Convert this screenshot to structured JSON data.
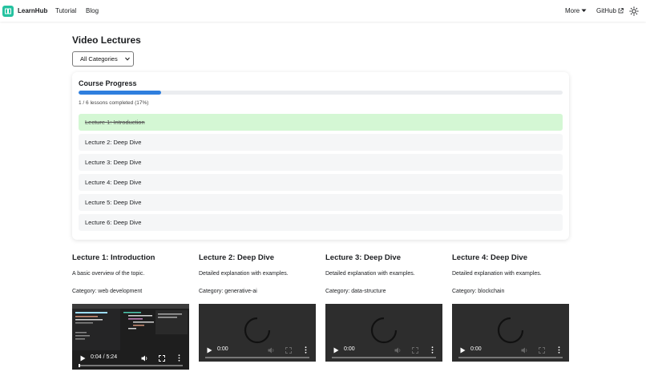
{
  "navbar": {
    "brand": "LearnHub",
    "links": [
      "Tutorial",
      "Blog"
    ],
    "more": "More",
    "github": "GitHub"
  },
  "page": {
    "title": "Video Lectures",
    "category_select": "All Categories"
  },
  "progress": {
    "title": "Course Progress",
    "fraction": 0.17,
    "text": "1 / 6 lessons completed (17%)",
    "lessons": [
      {
        "label": "Lecture 1: Introduction",
        "done": true
      },
      {
        "label": "Lecture 2: Deep Dive",
        "done": false
      },
      {
        "label": "Lecture 3: Deep Dive",
        "done": false
      },
      {
        "label": "Lecture 4: Deep Dive",
        "done": false
      },
      {
        "label": "Lecture 5: Deep Dive",
        "done": false
      },
      {
        "label": "Lecture 6: Deep Dive",
        "done": false
      }
    ]
  },
  "lectures": [
    {
      "title": "Lecture 1: Introduction",
      "desc": "A basic overview of the topic.",
      "category": "Category: web development",
      "time": "0:04 / 5:24",
      "played": 0.012
    },
    {
      "title": "Lecture 2: Deep Dive",
      "desc": "Detailed explanation with examples.",
      "category": "Category: generative-ai",
      "time": "0:00",
      "played": 0
    },
    {
      "title": "Lecture 3: Deep Dive",
      "desc": "Detailed explanation with examples.",
      "category": "Category: data-structure",
      "time": "0:00",
      "played": 0
    },
    {
      "title": "Lecture 4: Deep Dive",
      "desc": "Detailed explanation with examples.",
      "category": "Category: blockchain",
      "time": "0:00",
      "played": 0
    }
  ],
  "colors": {
    "brand": "#25c2a0",
    "progress_fill": "#2f7fde",
    "done_row": "#d4f7d4"
  }
}
